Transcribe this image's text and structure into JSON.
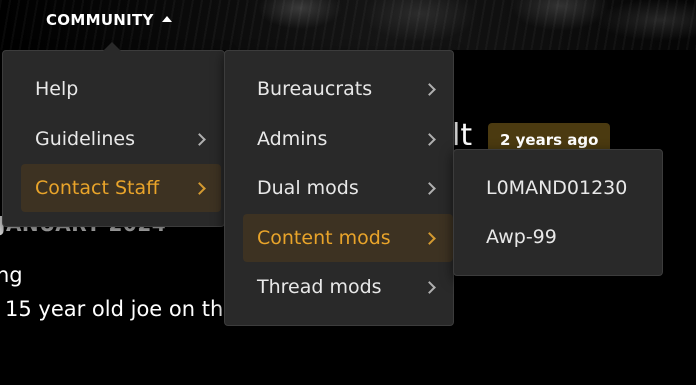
{
  "header": {
    "community_label": "COMMUNITY",
    "caret_icon": "caret-up-icon"
  },
  "background": {
    "title_left": "l",
    "title_right": "lt",
    "age_badge": "2 years ago",
    "date_text": "JANUARY 2024",
    "line1": "ng",
    "line2": "15 year old joe on th"
  },
  "menus": {
    "level1": {
      "items": [
        {
          "label": "Help",
          "has_submenu": false,
          "active": false
        },
        {
          "label": "Guidelines",
          "has_submenu": true,
          "active": false
        },
        {
          "label": "Contact Staff",
          "has_submenu": true,
          "active": true
        }
      ]
    },
    "level2": {
      "items": [
        {
          "label": "Bureaucrats",
          "has_submenu": true,
          "active": false
        },
        {
          "label": "Admins",
          "has_submenu": true,
          "active": false
        },
        {
          "label": "Dual mods",
          "has_submenu": true,
          "active": false
        },
        {
          "label": "Content mods",
          "has_submenu": true,
          "active": true
        },
        {
          "label": "Thread mods",
          "has_submenu": true,
          "active": false
        }
      ]
    },
    "level3": {
      "items": [
        {
          "label": "L0MAND01230"
        },
        {
          "label": "Awp-99"
        }
      ]
    }
  },
  "colors": {
    "accent": "#e9a42a",
    "active_bg": "#3d3222",
    "menu_bg": "#292929",
    "badge_bg": "#4b3a10"
  }
}
